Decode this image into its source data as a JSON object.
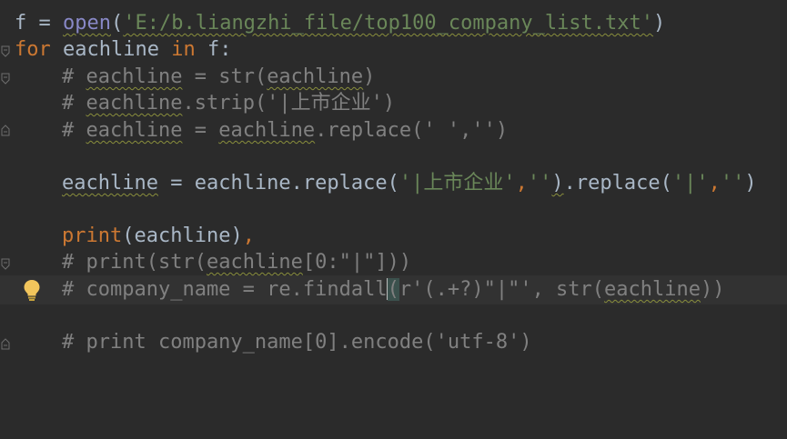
{
  "code": {
    "line1": {
      "var": "f",
      "eq": " = ",
      "func": "open",
      "lparen": "(",
      "path": "'E:/b.liangzhi_file/top100_company_list.txt'",
      "rparen": ")"
    },
    "line2": {
      "kw_for": "for",
      "var": " eachline ",
      "kw_in": "in",
      "rest": " f:"
    },
    "line3": {
      "hash": "# ",
      "var1": "eachline",
      "mid": " = str(",
      "var2": "eachline",
      "end": ")"
    },
    "line4": {
      "hash": "# ",
      "var1": "eachline",
      "rest": ".strip('|上市企业')"
    },
    "line5": {
      "hash": "# ",
      "var1": "eachline",
      "mid": " = ",
      "var2": "eachline",
      "rest": ".replace(' ','')"
    },
    "line6": {
      "var1": "eachline",
      "mid1": " = eachline.replace(",
      "s1": "'|上市企业'",
      "comma1": ",",
      "s2": "''",
      "rparen": ")",
      "mid2": ".replace(",
      "s3": "'|'",
      "comma2": ",",
      "s4": "''",
      "end": ")"
    },
    "line7": {
      "func": "print",
      "args": "(eachline)",
      "comma": ","
    },
    "line8": {
      "pre": "# print(str(",
      "var1": "eachline",
      "post": "[0:\"|\"]))"
    },
    "line9": {
      "pre": "# company_name = re.findall",
      "paren": "(",
      "mid": "r'(.+?)\"|\"', str(",
      "var1": "eachline",
      "end": "))"
    },
    "line10": {
      "text": "# print company_name[0].encode('utf-8')"
    }
  },
  "icons": {
    "intention_bulb": "lightbulb-icon",
    "fold_marker": "fold-marker-icon"
  },
  "colors": {
    "background": "#2b2b2b",
    "current_line": "#323232",
    "keyword": "#cc7832",
    "string": "#6a8759",
    "builtin": "#8888c6",
    "comment": "#808080",
    "text": "#a9b7c6",
    "bulb": "#f2c55c"
  }
}
